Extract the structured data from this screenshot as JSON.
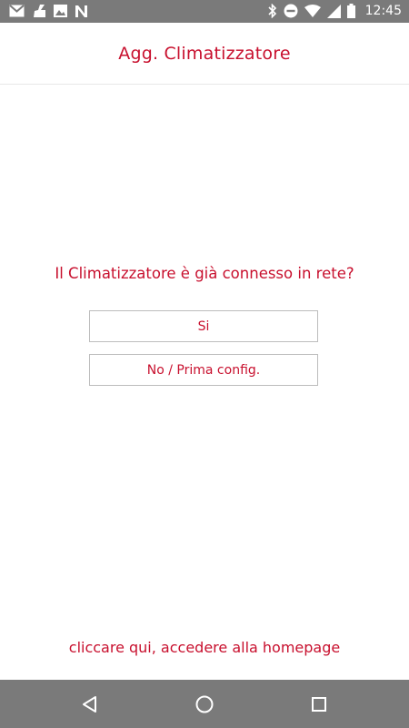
{
  "status_bar": {
    "time": "12:45",
    "left_icons": [
      "gmail-icon",
      "cleaner-icon",
      "image-icon",
      "n-app-icon"
    ],
    "right_icons": [
      "bluetooth-icon",
      "do-not-disturb-icon",
      "wifi-icon",
      "signal-icon",
      "battery-icon"
    ]
  },
  "header": {
    "title": "Agg. Climatizzatore"
  },
  "main": {
    "question": "Il Climatizzatore è già connesso in rete?",
    "yes_button": "Si",
    "no_button": "No / Prima config."
  },
  "footer": {
    "homepage_link": "cliccare qui, accedere alla homepage"
  },
  "colors": {
    "accent": "#c8102e",
    "status_bar": "#7a7a7a",
    "button_border": "#bdbdbd"
  }
}
